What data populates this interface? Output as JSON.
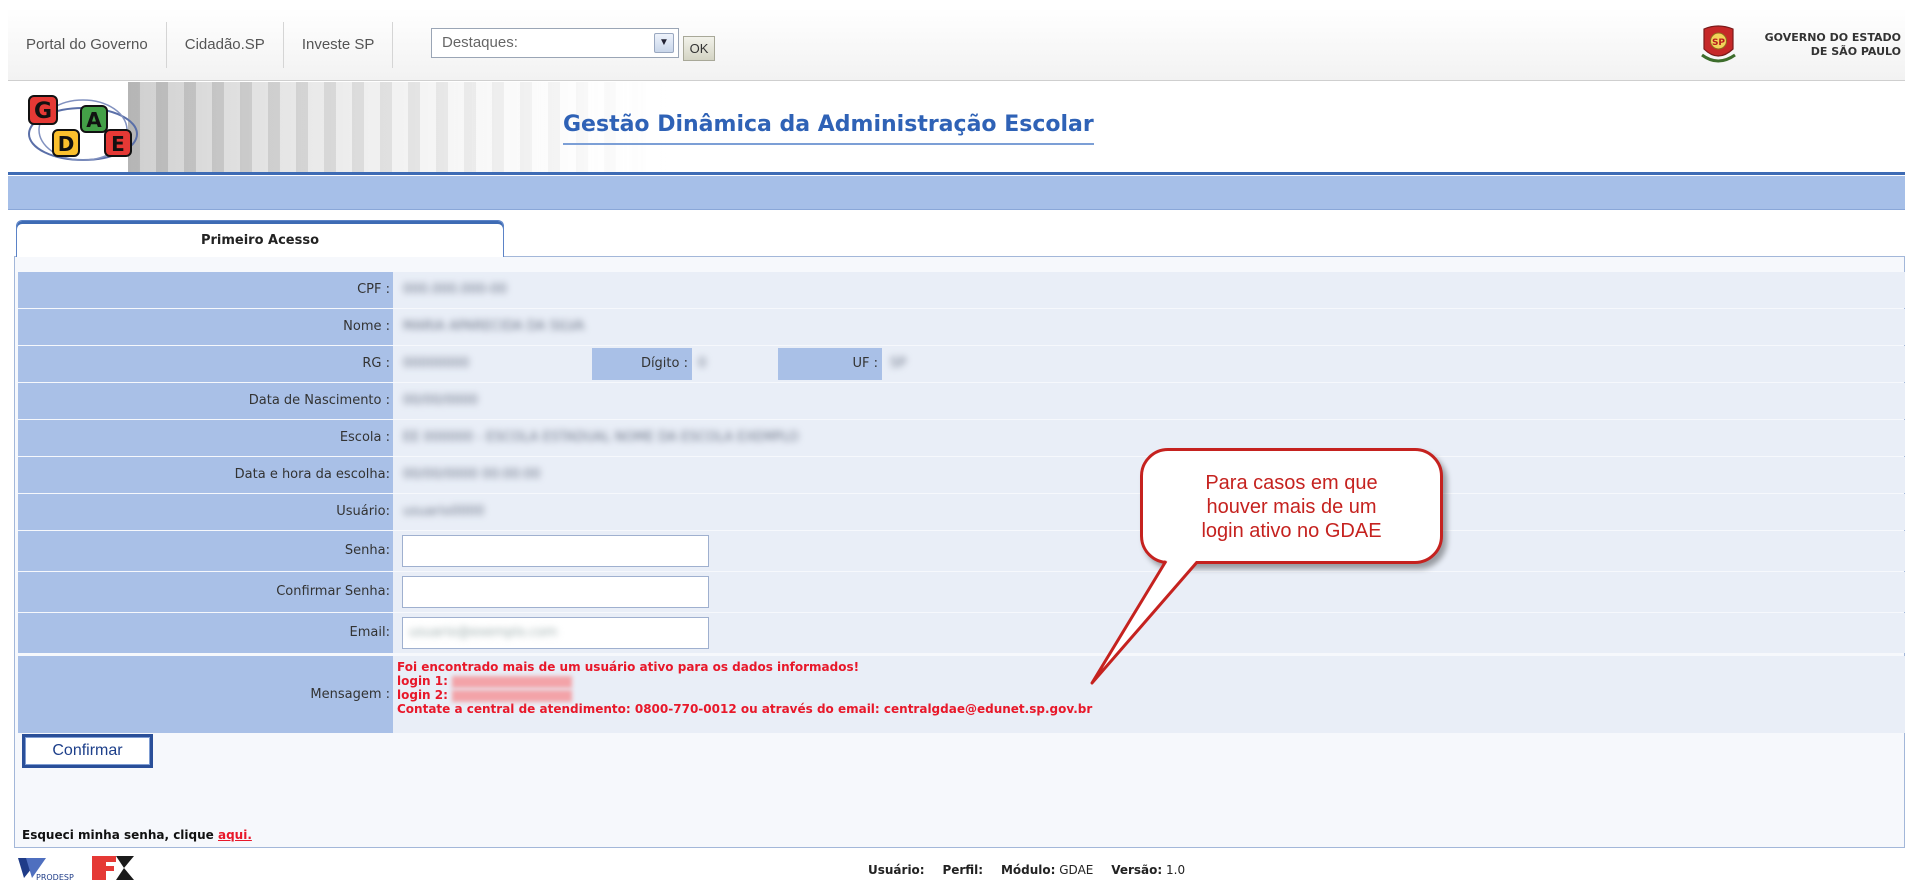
{
  "topbar": {
    "links": [
      "Portal do Governo",
      "Cidadão.SP",
      "Investe SP"
    ],
    "destaques_value": "Destaques:",
    "ok_label": "OK",
    "gov_line1": "GOVERNO DO ESTADO",
    "gov_line2": "DE SÃO PAULO"
  },
  "header": {
    "logo_text": "GDAE",
    "title": "Gestão Dinâmica da Administração Escolar"
  },
  "tab": {
    "label": "Primeiro Acesso"
  },
  "form": {
    "cpf_label": "CPF :",
    "cpf_value": "000.000.000-00",
    "nome_label": "Nome :",
    "nome_value": "MARIA APARECIDA DA SILVA",
    "rg_label": "RG :",
    "rg_value": "00000000",
    "digito_label": "Dígito :",
    "digito_value": "0",
    "uf_label": "UF :",
    "uf_value": "SP",
    "nascimento_label": "Data de Nascimento :",
    "nascimento_value": "00/00/0000",
    "escola_label": "Escola :",
    "escola_value": "EE 000000 - ESCOLA ESTADUAL NOME DA ESCOLA EXEMPLO",
    "data_escolha_label": "Data e hora da escolha:",
    "data_escolha_value": "00/00/0000 00:00:00",
    "usuario_label": "Usuário:",
    "usuario_value": "usuario0000",
    "senha_label": "Senha:",
    "confirmar_senha_label": "Confirmar Senha:",
    "email_label": "Email:",
    "email_value": "usuario@exemplo.com",
    "mensagem_label": "Mensagem :",
    "msg_line1": "Foi encontrado mais de um usuário ativo para os dados informados!",
    "msg_login1": "login 1:",
    "msg_login2": "login 2:",
    "msg_line4": "Contate a central de atendimento: 0800-770-0012 ou através do email: centralgdae@edunet.sp.gov.br"
  },
  "confirm_label": "Confirmar",
  "forgot": {
    "text": "Esqueci minha senha, clique ",
    "link": "aqui."
  },
  "footer": {
    "usuario_label": "Usuário:",
    "perfil_label": "Perfil:",
    "modulo_label": "Módulo:",
    "modulo_value": "GDAE",
    "versao_label": "Versão:",
    "versao_value": "1.0",
    "prodesp": "PRODESP"
  },
  "callout": {
    "text_line1": "Para casos em que",
    "text_line2": "houver mais de um",
    "text_line3": "login ativo no GDAE"
  },
  "colors": {
    "accent_blue": "#3e6bb4",
    "label_blue": "#a9c0e7",
    "error_red": "#e8182a",
    "callout_red": "#c5221f"
  }
}
